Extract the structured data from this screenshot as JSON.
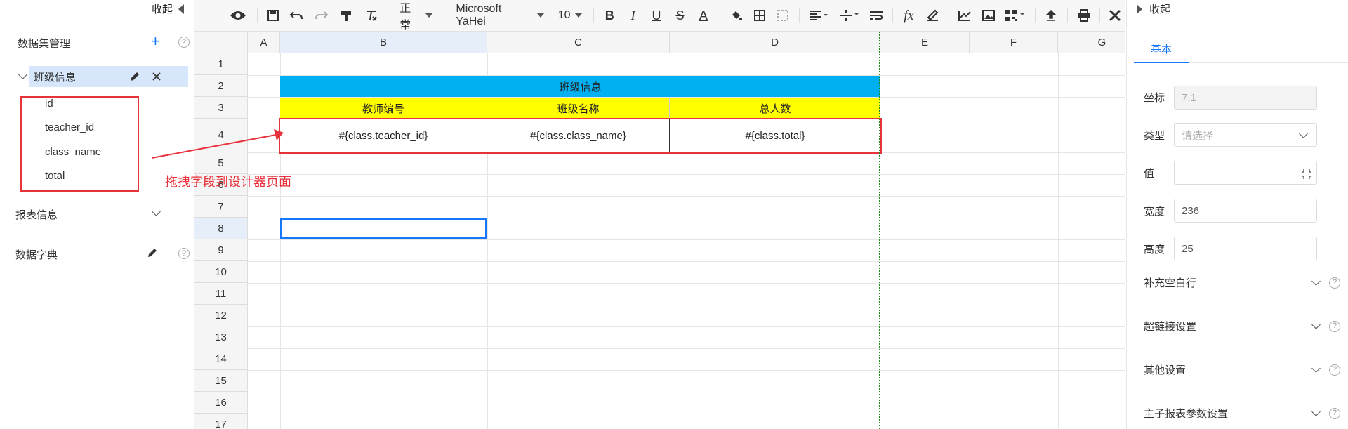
{
  "left_panel": {
    "collapse_label": "收起",
    "dataset_section": "数据集管理",
    "dataset_name": "班级信息",
    "fields": [
      "id",
      "teacher_id",
      "class_name",
      "total"
    ],
    "report_info": "报表信息",
    "dictionary": "数据字典"
  },
  "annotation": {
    "text": "拖拽字段到设计器页面",
    "color": "#e8323c"
  },
  "toolbar": {
    "style_select": "正常",
    "font_select": "Microsoft YaHei",
    "size_select": "10",
    "icons": [
      "preview-icon",
      "save-icon",
      "undo-icon",
      "redo-icon",
      "format-painter-icon",
      "clear-format-icon",
      "bold-icon",
      "italic-icon",
      "underline-icon",
      "strikethrough-icon",
      "font-color-icon",
      "fill-color-icon",
      "border-icon",
      "merge-icon",
      "align-icon",
      "valign-icon",
      "wrap-icon",
      "formula-icon",
      "sign-icon",
      "chart-icon",
      "image-icon",
      "qrcode-icon",
      "upload-icon",
      "print-icon",
      "tools-icon"
    ]
  },
  "sheet": {
    "columns": [
      "A",
      "B",
      "C",
      "D",
      "E",
      "F",
      "G"
    ],
    "rows": [
      "1",
      "2",
      "3",
      "4",
      "5",
      "6",
      "7",
      "8",
      "9",
      "10",
      "11",
      "12",
      "13",
      "14",
      "15",
      "16",
      "17"
    ],
    "title_cell": "班级信息",
    "headers": [
      "教师编号",
      "班级名称",
      "总人数"
    ],
    "expressions": [
      "#{class.teacher_id}",
      "#{class.class_name}",
      "#{class.total}"
    ],
    "colors": {
      "title_bg": "#00b0f0",
      "header_bg": "#ffff00",
      "page_break": "#1a8a1a",
      "selection": "#1677ff"
    }
  },
  "right_panel": {
    "collapse_label": "收起",
    "tab_basic": "基本",
    "coord_label": "坐标",
    "coord_value": "7,1",
    "type_label": "类型",
    "type_placeholder": "请选择",
    "value_label": "值",
    "width_label": "宽度",
    "width_value": "236",
    "height_label": "高度",
    "height_value": "25",
    "sections": [
      "补充空白行",
      "超链接设置",
      "其他设置",
      "主子报表参数设置"
    ]
  }
}
